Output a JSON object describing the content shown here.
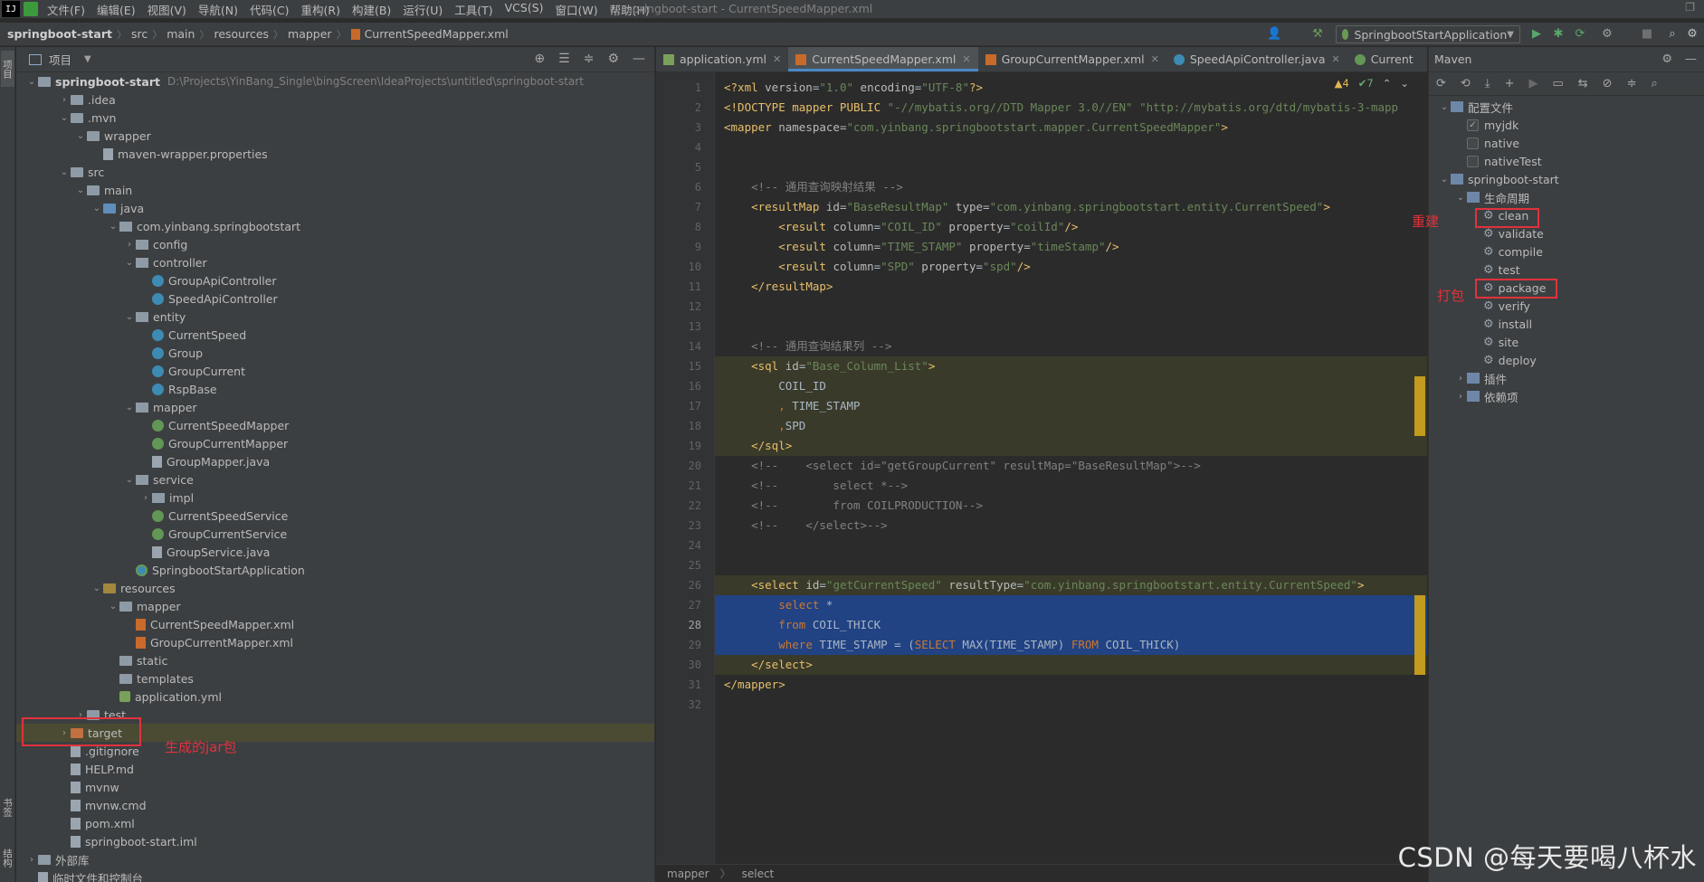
{
  "menubar": {
    "items": [
      "文件(F)",
      "编辑(E)",
      "视图(V)",
      "导航(N)",
      "代码(C)",
      "重构(R)",
      "构建(B)",
      "运行(U)",
      "工具(T)",
      "VCS(S)",
      "窗口(W)",
      "帮助(H)"
    ],
    "window_title": "springboot-start - CurrentSpeedMapper.xml"
  },
  "navbar": {
    "crumbs": [
      "springboot-start",
      "src",
      "main",
      "resources",
      "mapper",
      "CurrentSpeedMapper.xml"
    ],
    "run_config": "SpringbootStartApplication"
  },
  "leftstrip": {
    "project_tab": "项目",
    "bookmarks_tab": "书签",
    "structure_tab": "结构"
  },
  "project": {
    "title": "项目",
    "root_name": "springboot-start",
    "root_path": "D:\\Projects\\YinBang_Single\\bingScreen\\IdeaProjects\\untitled\\springboot-start",
    "rows": [
      {
        "label": ".idea"
      },
      {
        "label": ".mvn"
      },
      {
        "label": "wrapper"
      },
      {
        "label": "maven-wrapper.properties"
      },
      {
        "label": "src"
      },
      {
        "label": "main"
      },
      {
        "label": "java"
      },
      {
        "label": "com.yinbang.springbootstart"
      },
      {
        "label": "config"
      },
      {
        "label": "controller"
      },
      {
        "label": "GroupApiController"
      },
      {
        "label": "SpeedApiController"
      },
      {
        "label": "entity"
      },
      {
        "label": "CurrentSpeed"
      },
      {
        "label": "Group"
      },
      {
        "label": "GroupCurrent"
      },
      {
        "label": "RspBase"
      },
      {
        "label": "mapper"
      },
      {
        "label": "CurrentSpeedMapper"
      },
      {
        "label": "GroupCurrentMapper"
      },
      {
        "label": "GroupMapper.java"
      },
      {
        "label": "service"
      },
      {
        "label": "impl"
      },
      {
        "label": "CurrentSpeedService"
      },
      {
        "label": "GroupCurrentService"
      },
      {
        "label": "GroupService.java"
      },
      {
        "label": "SpringbootStartApplication"
      },
      {
        "label": "resources"
      },
      {
        "label": "mapper"
      },
      {
        "label": "CurrentSpeedMapper.xml"
      },
      {
        "label": "GroupCurrentMapper.xml"
      },
      {
        "label": "static"
      },
      {
        "label": "templates"
      },
      {
        "label": "application.yml"
      },
      {
        "label": "test"
      },
      {
        "label": "target"
      },
      {
        "label": ".gitignore"
      },
      {
        "label": "HELP.md"
      },
      {
        "label": "mvnw"
      },
      {
        "label": "mvnw.cmd"
      },
      {
        "label": "pom.xml"
      },
      {
        "label": "springboot-start.iml"
      },
      {
        "label": "外部库"
      },
      {
        "label": "临时文件和控制台"
      }
    ]
  },
  "editor": {
    "tabs": [
      {
        "label": "application.yml"
      },
      {
        "label": "CurrentSpeedMapper.xml"
      },
      {
        "label": "GroupCurrentMapper.xml"
      },
      {
        "label": "SpeedApiController.java"
      },
      {
        "label": "Current"
      }
    ],
    "warnings": "▲4",
    "checks": "✔7",
    "current_line": 28,
    "footer": [
      "mapper",
      "select"
    ]
  },
  "code_lines": [
    [
      [
        "tag",
        "<?xml "
      ],
      [
        "attr",
        "version"
      ],
      [
        "plain",
        "="
      ],
      [
        "val",
        "\"1.0\""
      ],
      [
        "plain",
        " "
      ],
      [
        "attr",
        "encoding"
      ],
      [
        "plain",
        "="
      ],
      [
        "val",
        "\"UTF-8\""
      ],
      [
        "tag",
        "?>"
      ]
    ],
    [
      [
        "tag",
        "<!DOCTYPE mapper PUBLIC "
      ],
      [
        "val",
        "\"-//mybatis.org//DTD Mapper 3.0//EN\""
      ],
      [
        "plain",
        " "
      ],
      [
        "val",
        "\"http://mybatis.org/dtd/mybatis-3-mapp"
      ]
    ],
    [
      [
        "tag",
        "<mapper "
      ],
      [
        "attr",
        "namespace"
      ],
      [
        "plain",
        "="
      ],
      [
        "val",
        "\"com.yinbang.springbootstart.mapper.CurrentSpeedMapper\""
      ],
      [
        "tag",
        ">"
      ]
    ],
    [],
    [],
    [
      [
        "plain",
        "    "
      ],
      [
        "cmt",
        "<!-- 通用查询映射结果 -->"
      ]
    ],
    [
      [
        "plain",
        "    "
      ],
      [
        "tag",
        "<resultMap "
      ],
      [
        "attr",
        "id"
      ],
      [
        "plain",
        "="
      ],
      [
        "val",
        "\"BaseResultMap\""
      ],
      [
        "plain",
        " "
      ],
      [
        "attr",
        "type"
      ],
      [
        "plain",
        "="
      ],
      [
        "val",
        "\"com.yinbang.springbootstart.entity.CurrentSpeed\""
      ],
      [
        "tag",
        ">"
      ]
    ],
    [
      [
        "plain",
        "        "
      ],
      [
        "tag",
        "<result "
      ],
      [
        "attr",
        "column"
      ],
      [
        "plain",
        "="
      ],
      [
        "val",
        "\"COIL_ID\""
      ],
      [
        "plain",
        " "
      ],
      [
        "attr",
        "property"
      ],
      [
        "plain",
        "="
      ],
      [
        "val",
        "\"coilId\""
      ],
      [
        "tag",
        "/>"
      ]
    ],
    [
      [
        "plain",
        "        "
      ],
      [
        "tag",
        "<result "
      ],
      [
        "attr",
        "column"
      ],
      [
        "plain",
        "="
      ],
      [
        "val",
        "\"TIME_STAMP\""
      ],
      [
        "plain",
        " "
      ],
      [
        "attr",
        "property"
      ],
      [
        "plain",
        "="
      ],
      [
        "val",
        "\"timeStamp\""
      ],
      [
        "tag",
        "/>"
      ]
    ],
    [
      [
        "plain",
        "        "
      ],
      [
        "tag",
        "<result "
      ],
      [
        "attr",
        "column"
      ],
      [
        "plain",
        "="
      ],
      [
        "val",
        "\"SPD\""
      ],
      [
        "plain",
        " "
      ],
      [
        "attr",
        "property"
      ],
      [
        "plain",
        "="
      ],
      [
        "val",
        "\"spd\""
      ],
      [
        "tag",
        "/>"
      ]
    ],
    [
      [
        "plain",
        "    "
      ],
      [
        "tag",
        "</resultMap>"
      ]
    ],
    [],
    [],
    [
      [
        "plain",
        "    "
      ],
      [
        "cmt",
        "<!-- 通用查询结果列 -->"
      ]
    ],
    [
      [
        "plain",
        "    "
      ],
      [
        "tag",
        "<sql "
      ],
      [
        "attr",
        "id"
      ],
      [
        "plain",
        "="
      ],
      [
        "val",
        "\"Base_Column_List\""
      ],
      [
        "tag",
        ">"
      ]
    ],
    [
      [
        "plain",
        "        COIL_ID"
      ]
    ],
    [
      [
        "plain",
        "        "
      ],
      [
        "kw",
        ", "
      ],
      [
        "plain",
        "TIME_STAMP"
      ]
    ],
    [
      [
        "plain",
        "        "
      ],
      [
        "kw",
        ","
      ],
      [
        "plain",
        "SPD"
      ]
    ],
    [
      [
        "plain",
        "    "
      ],
      [
        "tag",
        "</sql>"
      ]
    ],
    [
      [
        "plain",
        "    "
      ],
      [
        "cmt",
        "<!--    <select id=\"getGroupCurrent\" resultMap=\"BaseResultMap\">-->"
      ]
    ],
    [
      [
        "plain",
        "    "
      ],
      [
        "cmt",
        "<!--        select *-->"
      ]
    ],
    [
      [
        "plain",
        "    "
      ],
      [
        "cmt",
        "<!--        from COILPRODUCTION-->"
      ]
    ],
    [
      [
        "plain",
        "    "
      ],
      [
        "cmt",
        "<!--    </select>-->"
      ]
    ],
    [],
    [],
    [
      [
        "plain",
        "    "
      ],
      [
        "tag",
        "<select "
      ],
      [
        "attr",
        "id"
      ],
      [
        "plain",
        "="
      ],
      [
        "val",
        "\"getCurrentSpeed\""
      ],
      [
        "plain",
        " "
      ],
      [
        "attr",
        "resultType"
      ],
      [
        "plain",
        "="
      ],
      [
        "val",
        "\"com.yinbang.springbootstart.entity.CurrentSpeed\""
      ],
      [
        "tag",
        ">"
      ]
    ],
    [
      [
        "plain",
        "        "
      ],
      [
        "kw",
        "select "
      ],
      [
        "plain",
        "*"
      ]
    ],
    [
      [
        "plain",
        "        "
      ],
      [
        "kw",
        "from "
      ],
      [
        "plain",
        "COIL_THICK"
      ]
    ],
    [
      [
        "plain",
        "        "
      ],
      [
        "kw",
        "where "
      ],
      [
        "plain",
        "TIME_STAMP = ("
      ],
      [
        "kw",
        "SELECT "
      ],
      [
        "plain",
        "MAX(TIME_STAMP) "
      ],
      [
        "kw",
        "FROM "
      ],
      [
        "plain",
        "COIL_THICK)"
      ]
    ],
    [
      [
        "plain",
        "    "
      ],
      [
        "tag",
        "</select>"
      ]
    ],
    [
      [
        "tag",
        "</mapper>"
      ]
    ],
    []
  ],
  "maven": {
    "title": "Maven",
    "rows": [
      {
        "label": "配置文件"
      },
      {
        "label": "myjdk",
        "checked": true
      },
      {
        "label": "native",
        "checked": false
      },
      {
        "label": "nativeTest",
        "checked": false
      },
      {
        "label": "springboot-start"
      },
      {
        "label": "生命周期"
      },
      {
        "label": "clean"
      },
      {
        "label": "validate"
      },
      {
        "label": "compile"
      },
      {
        "label": "test"
      },
      {
        "label": "package"
      },
      {
        "label": "verify"
      },
      {
        "label": "install"
      },
      {
        "label": "site"
      },
      {
        "label": "deploy"
      },
      {
        "label": "插件"
      },
      {
        "label": "依赖项"
      }
    ]
  },
  "annotations": {
    "rebuild": "重建",
    "package": "打包",
    "jar": "生成的jar包"
  },
  "watermark": "CSDN @每天要喝八杯水",
  "colors": {
    "accent_red": "#e0323c",
    "selection_blue": "#214283",
    "tab_underline": "#4a88c7"
  }
}
